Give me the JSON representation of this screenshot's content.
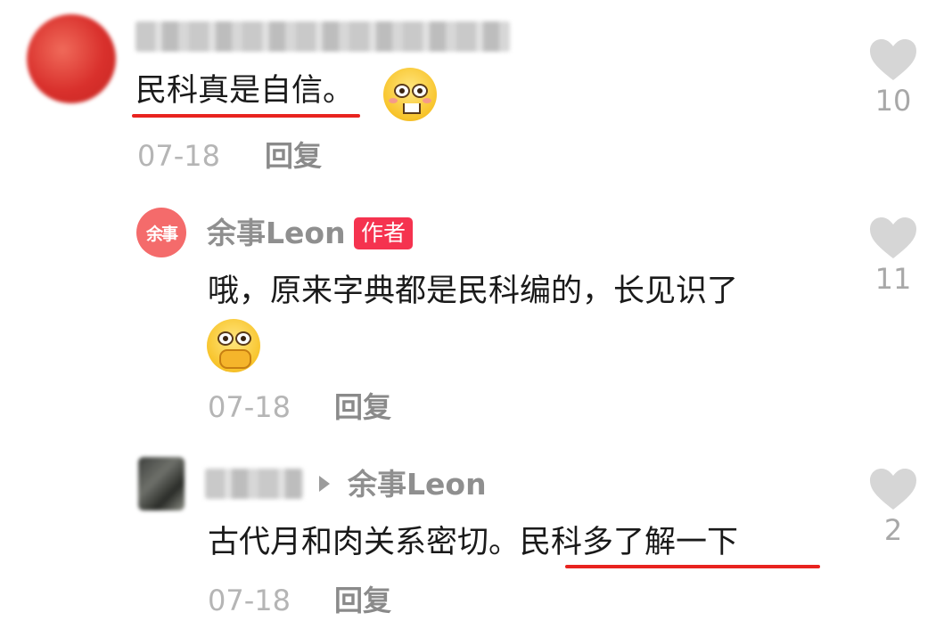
{
  "comments": [
    {
      "text": "民科真是自信。",
      "date": "07-18",
      "reply_label": "回复",
      "likes": "10",
      "emoji": "grin-emoji",
      "highlighted": "民科真是自信"
    },
    {
      "author": "余事Leon",
      "author_badge": "作者",
      "avatar_text": "余事",
      "text": "哦，原来字典都是民科编的，长见识了",
      "emoji": "cover-mouth-emoji",
      "date": "07-18",
      "reply_label": "回复",
      "likes": "11"
    },
    {
      "reply_to": "余事Leon",
      "text_plain": "古代月和肉关系密切。",
      "text_highlight": "民科多了解一下",
      "date": "07-18",
      "reply_label": "回复",
      "likes": "2"
    }
  ],
  "colors": {
    "underline": "#e8231f",
    "badge": "#f5334f",
    "heart": "#d6d6d6"
  }
}
